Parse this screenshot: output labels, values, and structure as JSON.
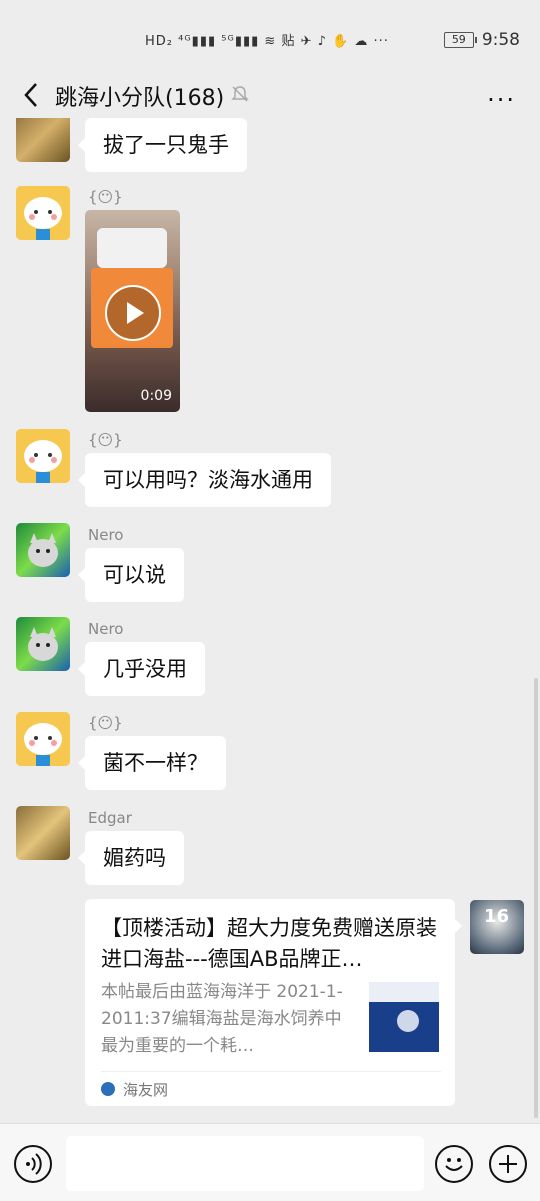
{
  "status_bar": {
    "network_icons": "HD₂ ⁴ᴳ▮▮▮ ⁵ᴳ▮▮▮ ≋ 贴 ✈ ♪ ✋ ☁ ···",
    "battery": "59",
    "time": "9:58"
  },
  "header": {
    "title": "跳海小分队(168)",
    "more": "···"
  },
  "messages": [
    {
      "sender": "",
      "text": "拔了一只鬼手"
    },
    {
      "sender": "{😶}",
      "video_duration": "0:09"
    },
    {
      "sender": "{😶}",
      "text": "可以用吗？淡海水通用"
    },
    {
      "sender": "Nero",
      "text": "可以说"
    },
    {
      "sender": "Nero",
      "text": "几乎没用"
    },
    {
      "sender": "{😶}",
      "text": "菌不一样？"
    },
    {
      "sender": "Edgar",
      "text": "媚药吗"
    }
  ],
  "link_card": {
    "title": "【顶楼活动】超大力度免费赠送原装进口海盐---德国AB品牌正…",
    "desc": "本帖最后由蓝海海洋于 2021-1-2011:37编辑海盐是海水饲养中最为重要的一个耗…",
    "source": "海友网",
    "avatar_badge": "16"
  }
}
